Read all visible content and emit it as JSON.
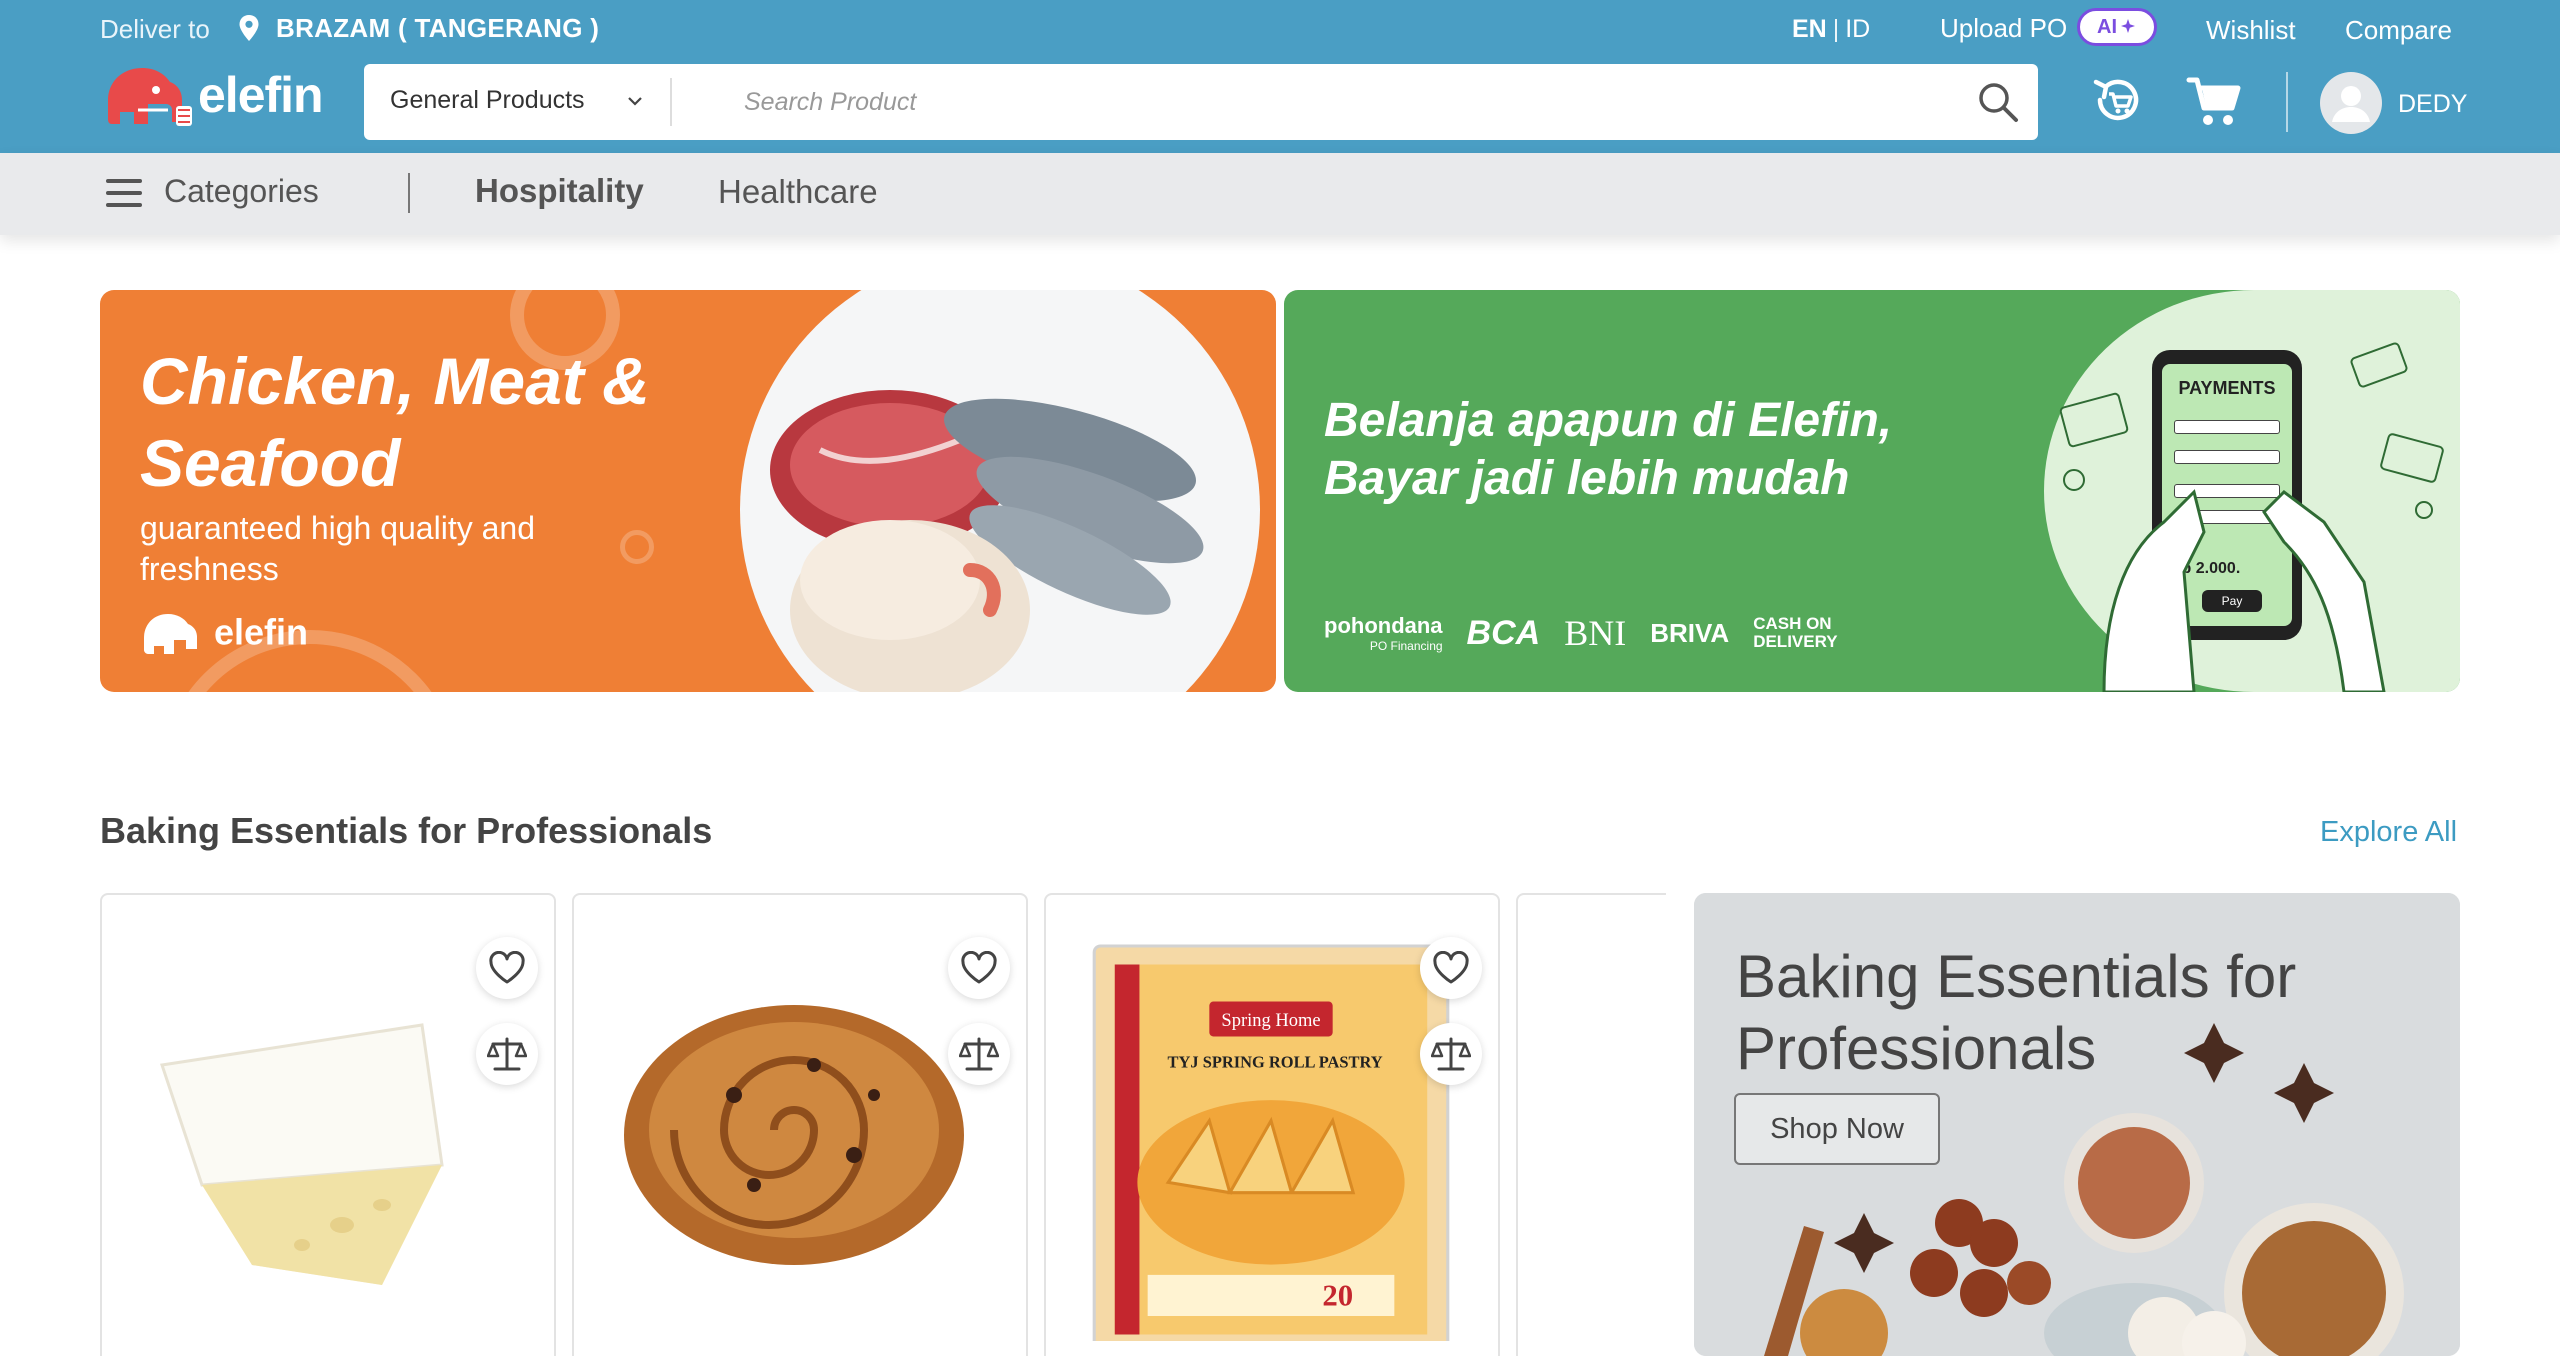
{
  "header": {
    "deliver_label": "Deliver to",
    "deliver_location": "BRAZAM ( TANGERANG )",
    "lang_en": "EN",
    "lang_sep": "|",
    "lang_id": "ID",
    "upload_po": "Upload PO",
    "ai_badge": "AI",
    "wishlist": "Wishlist",
    "compare": "Compare",
    "logo_text": "elefin",
    "search": {
      "category": "General Products",
      "placeholder": "Search Product"
    },
    "user_name": "DEDY",
    "colors": {
      "bar": "#4a9ec4",
      "ai_accent": "#7b4de0"
    }
  },
  "nav": {
    "categories": "Categories",
    "items": [
      "Hospitality",
      "Healthcare"
    ]
  },
  "banners": [
    {
      "title": "Chicken, Meat & Seafood",
      "subtitle": "guaranteed high quality and freshness",
      "logo": "elefin",
      "color": "#ef7f35"
    },
    {
      "title": "Belanja apapun di Elefin, Bayar jadi lebih mudah",
      "payment_logos": [
        "pohondana",
        "PO Financing",
        "BCA",
        "BNI",
        "BRIVA",
        "CASH ON DELIVERY"
      ],
      "phone_title": "PAYMENTS",
      "phone_amount": "Rp 2.000.",
      "phone_button": "Pay",
      "color": "#55a95a"
    }
  ],
  "section": {
    "title": "Baking Essentials for Professionals",
    "explore": "Explore All",
    "products": [
      {
        "image": "brie-cheese"
      },
      {
        "image": "raisin-danish-pastry"
      },
      {
        "image": "spring-roll-pastry-pack",
        "brand": "Spring Home",
        "label": "TYJ SPRING ROLL PASTRY",
        "count": "20"
      },
      {
        "image": "partial-product"
      }
    ],
    "promo": {
      "title": "Baking Essentials for Professionals",
      "button": "Shop Now"
    },
    "accent": "#3c9bc2"
  }
}
